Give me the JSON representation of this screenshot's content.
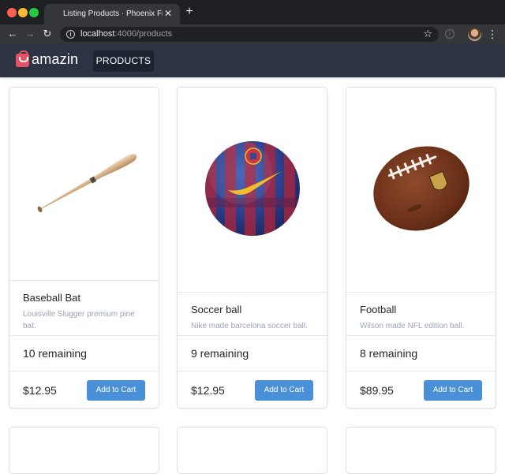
{
  "browser": {
    "tab_title": "Listing Products · Phoenix Fran",
    "url_host": "localhost",
    "url_path": ":4000/products",
    "back_icon": "←",
    "forward_icon": "→",
    "reload_icon": "↻",
    "close_icon": "✕",
    "new_tab_icon": "+",
    "star_icon": "☆",
    "menu_icon": "⋮",
    "info_glyph": "i"
  },
  "header": {
    "logo_text": "amazin",
    "nav": {
      "products": "PRODUCTS"
    },
    "background": "#2c3444",
    "logo_color": "#e55263"
  },
  "products": [
    {
      "name": "Baseball Bat",
      "description": "Louisville Slugger premium pine bat.",
      "stock": "10 remaining",
      "price": "$12.95",
      "button": "Add to Cart",
      "image_icon": "baseball-bat-image"
    },
    {
      "name": "Soccer ball",
      "description": "Nike made barcelona soccer ball.",
      "stock": "9 remaining",
      "price": "$12.95",
      "button": "Add to Cart",
      "image_icon": "soccer-ball-image"
    },
    {
      "name": "Football",
      "description": "Wilson made NFL edition ball.",
      "stock": "8 remaining",
      "price": "$89.95",
      "button": "Add to Cart",
      "image_icon": "football-image"
    }
  ],
  "colors": {
    "button": "#4a90d9",
    "muted_text": "#9aa3b5"
  }
}
